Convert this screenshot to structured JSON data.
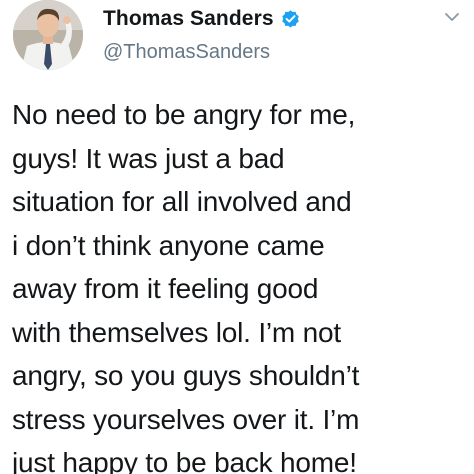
{
  "author": {
    "display_name": "Thomas Sanders",
    "handle": "@ThomasSanders",
    "verified": true,
    "verified_icon": "verified-badge-icon",
    "avatar_icon": "profile-photo"
  },
  "menu": {
    "icon": "chevron-down-icon"
  },
  "tweet": {
    "text": "No need to be angry for me,\nguys! It was just a bad\nsituation for all involved and\ni don’t think anyone came\naway from it feeling good\nwith themselves lol. I’m not\nangry, so you guys shouldn’t\nstress yourselves over it. I’m\njust happy to be back home!"
  },
  "colors": {
    "verified_blue": "#1da1f2",
    "text": "#14171a",
    "secondary": "#657786"
  }
}
